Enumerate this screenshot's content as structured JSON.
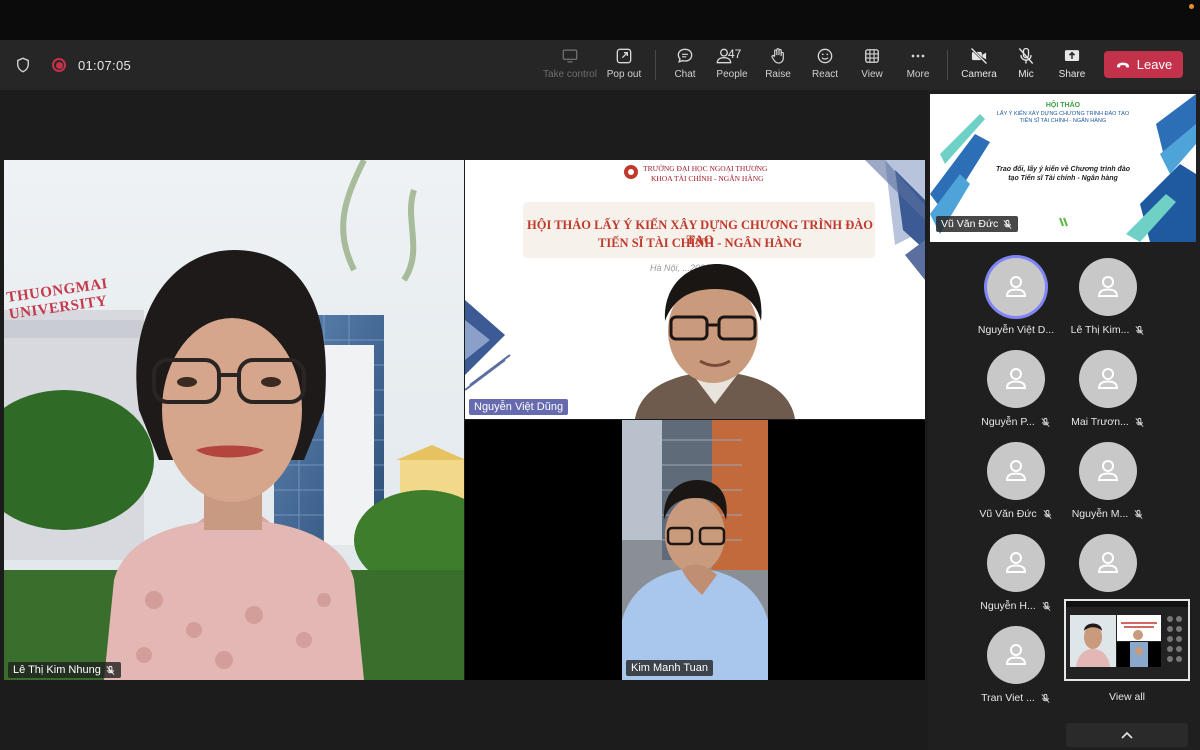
{
  "meeting": {
    "timer": "01:07:05"
  },
  "toolbar": {
    "take_control": "Take control",
    "pop_out": "Pop out",
    "chat": "Chat",
    "people": "People",
    "people_count": "47",
    "raise": "Raise",
    "react": "React",
    "view": "View",
    "more": "More",
    "camera": "Camera",
    "mic": "Mic",
    "share": "Share",
    "leave": "Leave"
  },
  "stage": {
    "left_tile_name": "Lê Thị Kim Nhung",
    "building_sign": "THUONGMAI UNIVERSITY",
    "slide": {
      "university": "TRƯỜNG ĐẠI HỌC NGOẠI THƯƠNG",
      "faculty": "KHOA TÀI CHÍNH - NGÂN HÀNG",
      "title_line1": "HỘI THẢO LẤY Ý KIẾN XÂY DỰNG CHƯƠNG TRÌNH ĐÀO TẠO",
      "title_line2": "TIẾN SĨ TÀI CHÍNH - NGÂN HÀNG",
      "place_date": "Hà Nội, ...2023"
    },
    "top_right_tile_name": "Nguyễn Việt Dũng",
    "bottom_tile_name": "Kim Manh Tuan"
  },
  "sidebar": {
    "share_tile": {
      "name": "Vũ Văn Đức",
      "title": "HỘI THẢO",
      "subtitle1": "LẤY Ý KIẾN XÂY DỰNG CHƯƠNG TRÌNH ĐÀO TẠO",
      "subtitle2": "TIẾN SĨ TÀI CHÍNH - NGÂN HÀNG",
      "body1": "Trao đổi, lấy ý kiến về Chương trình đào",
      "body2": "tạo Tiến sĩ Tài chính - Ngân hàng"
    },
    "participants": [
      {
        "name": "Nguyễn Việt D...",
        "muted": false
      },
      {
        "name": "Lê Thị Kim...",
        "muted": true
      },
      {
        "name": "Nguyễn P...",
        "muted": true
      },
      {
        "name": "Mai Trươn...",
        "muted": true
      },
      {
        "name": "Vũ Văn Đức",
        "muted": true
      },
      {
        "name": "Nguyễn M...",
        "muted": true
      },
      {
        "name": "Nguyễn H...",
        "muted": true
      },
      {
        "name": "Tran Viet ...",
        "muted": true
      }
    ],
    "view_all": "View all"
  }
}
